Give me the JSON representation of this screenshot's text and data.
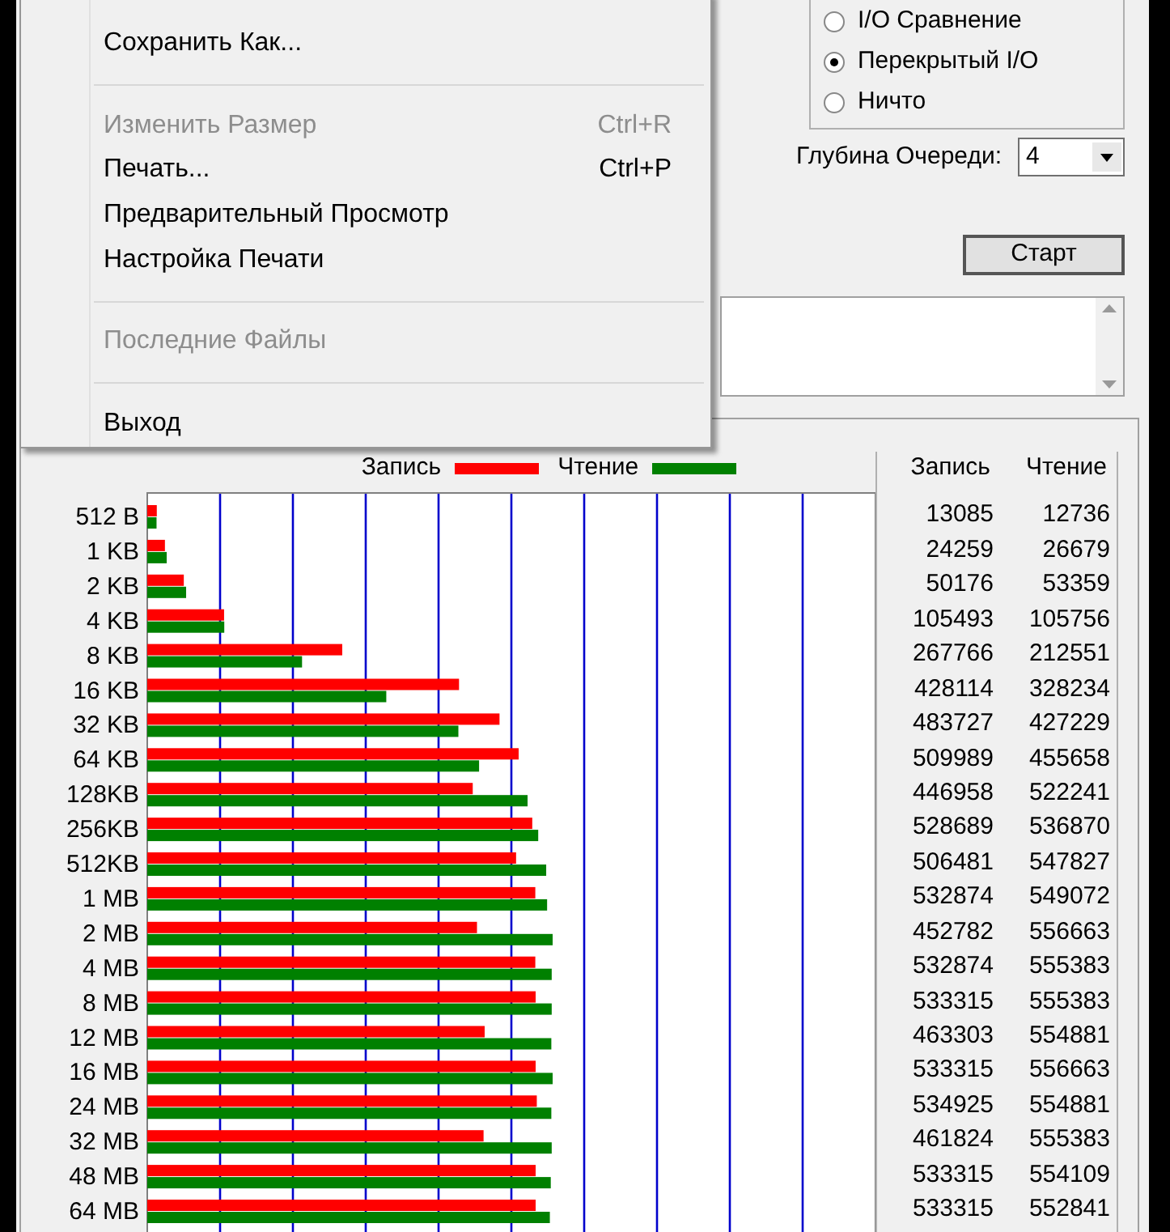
{
  "menu": {
    "items": [
      {
        "kind": "item",
        "label": "Сохранить Как...",
        "disabled": false
      },
      {
        "kind": "separator"
      },
      {
        "kind": "item",
        "label": "Изменить Размер",
        "shortcut": "Ctrl+R",
        "disabled": true
      },
      {
        "kind": "item",
        "label": "Печать...",
        "shortcut": "Ctrl+P",
        "disabled": false
      },
      {
        "kind": "item",
        "label": "Предварительный Просмотр",
        "disabled": false
      },
      {
        "kind": "item",
        "label": "Настройка Печати",
        "disabled": false
      },
      {
        "kind": "separator"
      },
      {
        "kind": "item",
        "label": "Последние Файлы",
        "disabled": true
      },
      {
        "kind": "separator"
      },
      {
        "kind": "item",
        "label": "Выход",
        "disabled": false
      }
    ]
  },
  "transfer_mode": {
    "options": [
      {
        "label": "I/O Сравнение",
        "selected": false
      },
      {
        "label": "Перекрытый I/O",
        "selected": true
      },
      {
        "label": "Ничто",
        "selected": false
      }
    ]
  },
  "queue_depth": {
    "label": "Глубина Очереди:",
    "value": "4"
  },
  "start_button": {
    "label": "Старт"
  },
  "results": {
    "legend": [
      {
        "label": "Запись",
        "color": "#ff0000"
      },
      {
        "label": "Чтение",
        "color": "#008000"
      }
    ],
    "categories": [
      "512 B",
      "1 KB",
      "2 KB",
      "4 KB",
      "8 KB",
      "16 KB",
      "32 KB",
      "64 KB",
      "128KB",
      "256KB",
      "512KB",
      "1 MB",
      "2 MB",
      "4 MB",
      "8 MB",
      "12 MB",
      "16 MB",
      "24 MB",
      "32 MB",
      "48 MB",
      "64 MB"
    ],
    "columns": [
      "Запись",
      "Чтение"
    ],
    "rows": [
      [
        "13085",
        "12736"
      ],
      [
        "24259",
        "26679"
      ],
      [
        "50176",
        "53359"
      ],
      [
        "105493",
        "105756"
      ],
      [
        "267766",
        "212551"
      ],
      [
        "428114",
        "328234"
      ],
      [
        "483727",
        "427229"
      ],
      [
        "509989",
        "455658"
      ],
      [
        "446958",
        "522241"
      ],
      [
        "528689",
        "536870"
      ],
      [
        "506481",
        "547827"
      ],
      [
        "532874",
        "549072"
      ],
      [
        "452782",
        "556663"
      ],
      [
        "532874",
        "555383"
      ],
      [
        "533315",
        "555383"
      ],
      [
        "463303",
        "554881"
      ],
      [
        "533315",
        "556663"
      ],
      [
        "534925",
        "554881"
      ],
      [
        "461824",
        "555383"
      ],
      [
        "533315",
        "554109"
      ],
      [
        "533315",
        "552841"
      ]
    ]
  }
}
